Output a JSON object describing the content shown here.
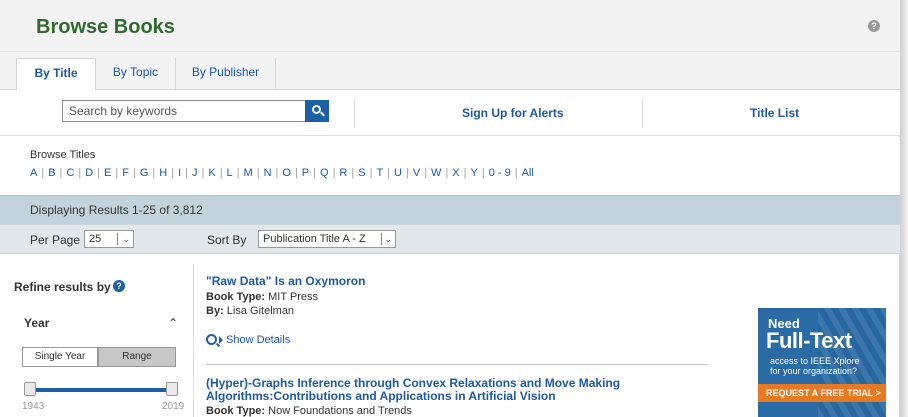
{
  "header": {
    "title": "Browse Books"
  },
  "tabs": [
    {
      "label": "By Title",
      "active": true
    },
    {
      "label": "By Topic",
      "active": false
    },
    {
      "label": "By Publisher",
      "active": false
    }
  ],
  "search": {
    "placeholder": "Search by keywords"
  },
  "actions": {
    "alerts": "Sign Up for Alerts",
    "title_list": "Title List"
  },
  "browse": {
    "label": "Browse Titles",
    "letters": [
      "A",
      "B",
      "C",
      "D",
      "E",
      "F",
      "G",
      "H",
      "I",
      "J",
      "K",
      "L",
      "M",
      "N",
      "O",
      "P",
      "Q",
      "R",
      "S",
      "T",
      "U",
      "V",
      "W",
      "X",
      "Y",
      "0 - 9",
      "All"
    ]
  },
  "results_summary": "Displaying Results 1-25 of 3,812",
  "controls": {
    "per_page_label": "Per Page",
    "per_page_value": "25",
    "sort_label": "Sort By",
    "sort_value": "Publication Title A - Z"
  },
  "sidebar": {
    "refine_title": "Refine results by",
    "year_label": "Year",
    "tab_single": "Single Year",
    "tab_range": "Range",
    "year_min": "1943",
    "year_max": "2019"
  },
  "results": [
    {
      "title": "\"Raw Data\" Is an Oxymoron",
      "book_type_label": "Book Type:",
      "book_type": "MIT Press",
      "by_label": "By:",
      "author": "Lisa Gitelman",
      "show_details": "Show Details"
    },
    {
      "title_line1": "(Hyper)-Graphs Inference through Convex Relaxations and Move Making",
      "title_line2": "Algorithms:Contributions and Applications in Artificial Vision",
      "book_type_label": "Book Type:",
      "book_type": "Now Foundations and Trends"
    }
  ],
  "ad": {
    "need": "Need",
    "full_text": "Full-Text",
    "sub1": "access to IEEE Xplore",
    "sub2": "for your organization?",
    "cta": "REQUEST A FREE TRIAL >"
  },
  "colors": {
    "title_green": "#2f6b2f",
    "link_blue": "#1a5aa8",
    "results_bar": "#c3d3dc",
    "cta_orange": "#e67a23"
  }
}
